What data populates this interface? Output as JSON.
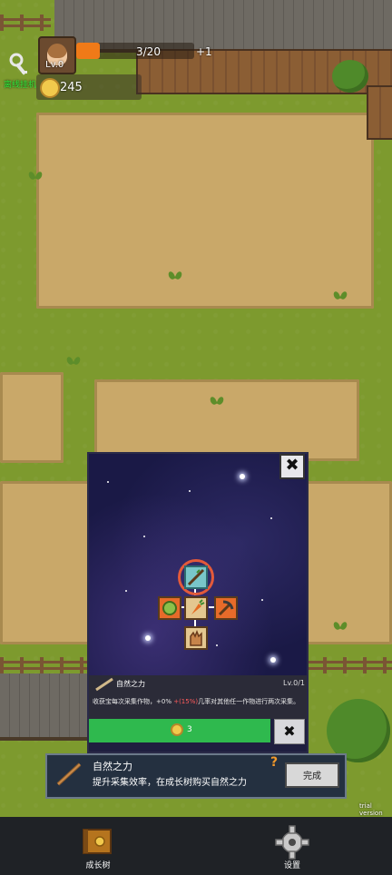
{
  "hud": {
    "level": "Lv.0",
    "progress_text": "3/20",
    "progress_fraction": 0.15,
    "bonus": "+1",
    "coins": "245",
    "hang_label": "离线挂机"
  },
  "skill_panel": {
    "close_symbol": "✖",
    "skill_name": "自然之力",
    "skill_level": "Lv.0/1",
    "desc_prefix": "收获宝每次采集作物，+0% ",
    "desc_highlight": "+(15%)",
    "desc_suffix": "几率对其他任一作物进行两次采集。",
    "price": "3",
    "cancel_symbol": "✖"
  },
  "tutorial": {
    "title": "自然之力",
    "description": "提升采集效率，在成长树购买自然之力",
    "hint_symbol": "?",
    "done_label": "完成"
  },
  "watermark": "trial version",
  "bottom_nav": {
    "growth_tree_label": "成长树",
    "settings_label": "设置"
  },
  "colors": {
    "accent_orange": "#f07a18",
    "buy_green": "#2fb94e",
    "ring_red": "#e35a3a"
  }
}
